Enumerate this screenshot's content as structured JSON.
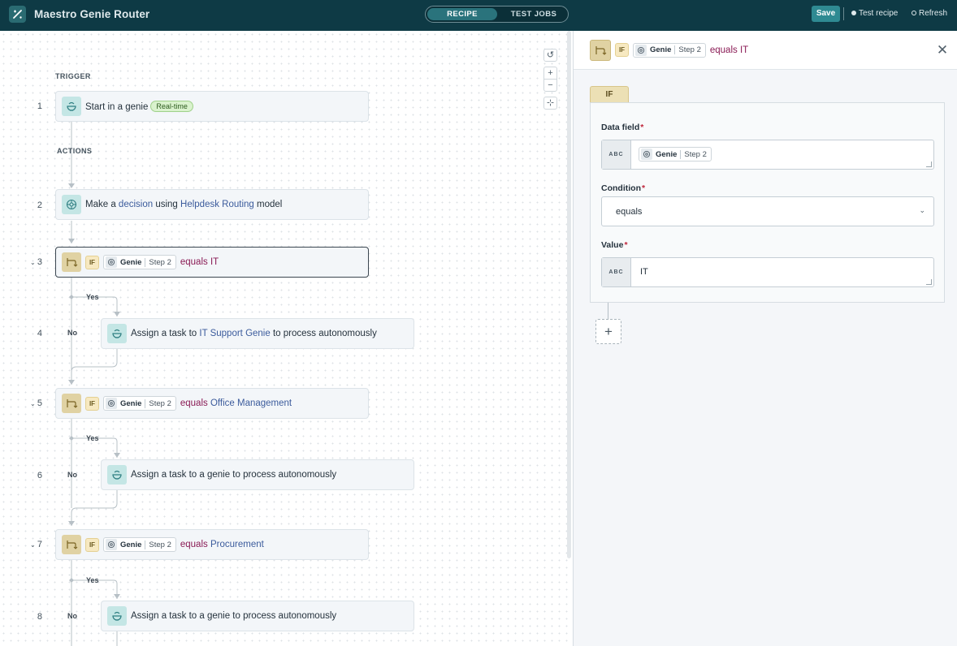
{
  "header": {
    "app_title": "Maestro Genie Router",
    "tabs": [
      {
        "label": "RECIPE",
        "active": true
      },
      {
        "label": "TEST JOBS",
        "active": false
      }
    ],
    "save_label": "Save",
    "test_recipe_label": "Test recipe",
    "refresh_label": "Refresh"
  },
  "colors": {
    "topbar": "#0e3a45",
    "accent": "#2f8a92",
    "keyword": "#8a1b55",
    "link": "#3b5b9c"
  },
  "canvas": {
    "trigger_label": "TRIGGER",
    "actions_label": "ACTIONS",
    "zoom_controls": [
      "reset-icon",
      "zoom-in-icon",
      "zoom-out-icon",
      "fit-icon"
    ],
    "branch_yes": "Yes",
    "branch_no": "No",
    "steps": [
      {
        "number": "1",
        "text": "Start in a genie",
        "badge": "Real-time",
        "icon": "genie-icon"
      },
      {
        "number": "2",
        "pre": "Make a",
        "link1": "decision",
        "mid": "using",
        "link2": "Helpdesk Routing",
        "post": "model",
        "icon": "ai-icon"
      },
      {
        "number": "3",
        "if_label": "IF",
        "pill_genie": "Genie",
        "pill_step": "Step 2",
        "op": "equals",
        "value": "IT",
        "icon": "route-icon"
      },
      {
        "number": "4",
        "pre": "Assign a task to",
        "link": "IT Support Genie",
        "post": "to process autonomously",
        "icon": "genie-icon"
      },
      {
        "number": "5",
        "if_label": "IF",
        "pill_genie": "Genie",
        "pill_step": "Step 2",
        "op": "equals",
        "value": "Office Management",
        "icon": "route-icon"
      },
      {
        "number": "6",
        "text": "Assign a task to a genie to process autonomously",
        "icon": "genie-icon"
      },
      {
        "number": "7",
        "if_label": "IF",
        "pill_genie": "Genie",
        "pill_step": "Step 2",
        "op": "equals",
        "value": "Procurement",
        "icon": "route-icon"
      },
      {
        "number": "8",
        "text": "Assign a task to a genie to process autonomously",
        "icon": "genie-icon"
      }
    ]
  },
  "panel": {
    "if_label": "IF",
    "pill_genie": "Genie",
    "pill_step": "Step 2",
    "op": "equals",
    "value": "IT",
    "tab_label": "IF",
    "data_field": {
      "label": "Data field",
      "required": "*",
      "type_label": "ABC",
      "pill_genie": "Genie",
      "pill_step": "Step 2"
    },
    "condition": {
      "label": "Condition",
      "required": "*",
      "value": "equals"
    },
    "value_field": {
      "label": "Value",
      "required": "*",
      "type_label": "ABC",
      "value": "IT"
    }
  }
}
